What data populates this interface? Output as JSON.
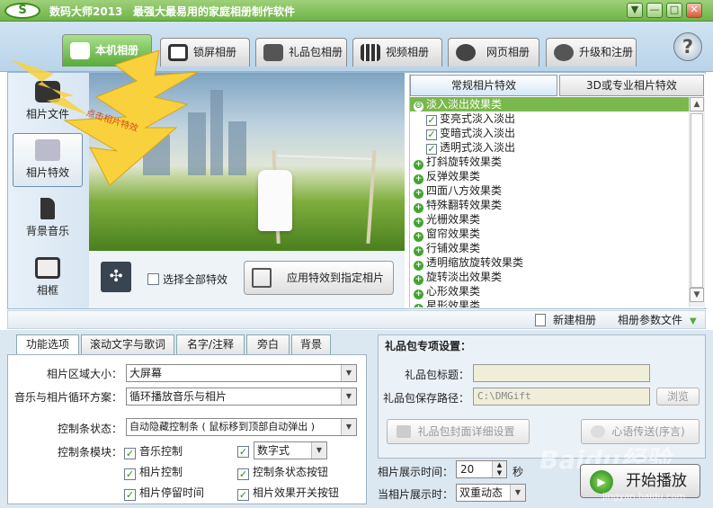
{
  "titlebar": {
    "logo_text": "S",
    "app_name": "数码大师2013",
    "slogan": "最强大最易用的家庭相册制作软件",
    "window_buttons": [
      "▼",
      "—",
      "□",
      "✕"
    ]
  },
  "top_tabs": [
    {
      "label": "本机相册",
      "icon": "photo-album-icon",
      "active": true
    },
    {
      "label": "锁屏相册",
      "icon": "monitor-icon"
    },
    {
      "label": "礼品包相册",
      "icon": "gift-icon"
    },
    {
      "label": "视频相册",
      "icon": "film-icon"
    },
    {
      "label": "网页相册",
      "icon": "ie-icon"
    },
    {
      "label": "升级和注册",
      "icon": "globe-icon"
    }
  ],
  "help_label": "?",
  "left_nav": [
    {
      "label": "相片文件",
      "icon": "camera-icon"
    },
    {
      "label": "相片特效",
      "icon": "effects-icon",
      "active": true
    },
    {
      "label": "背景音乐",
      "icon": "music-note-icon"
    },
    {
      "label": "相框",
      "icon": "frame-icon"
    }
  ],
  "callout_text": "点击相片特效",
  "photo_controls": {
    "select_all_label": "选择全部特效",
    "apply_button": "应用特效到指定相片"
  },
  "effect_tabs": [
    "常规相片特效",
    "3D或专业相片特效"
  ],
  "effect_tree": [
    {
      "label": "淡入淡出效果类",
      "type": "expanded",
      "selected": true
    },
    {
      "label": "变亮式淡入淡出",
      "type": "child",
      "checked": true
    },
    {
      "label": "变暗式淡入淡出",
      "type": "child",
      "checked": true
    },
    {
      "label": "透明式淡入淡出",
      "type": "child",
      "checked": true
    },
    {
      "label": "打斜旋转效果类",
      "type": "collapsed"
    },
    {
      "label": "反弹效果类",
      "type": "collapsed"
    },
    {
      "label": "四面八方效果类",
      "type": "collapsed"
    },
    {
      "label": "特殊翻转效果类",
      "type": "collapsed"
    },
    {
      "label": "光栅效果类",
      "type": "collapsed"
    },
    {
      "label": "窗帘效果类",
      "type": "collapsed"
    },
    {
      "label": "行铺效果类",
      "type": "collapsed"
    },
    {
      "label": "透明缩放旋转效果类",
      "type": "collapsed"
    },
    {
      "label": "旋转淡出效果类",
      "type": "collapsed"
    },
    {
      "label": "心形效果类",
      "type": "collapsed"
    },
    {
      "label": "星形效果类",
      "type": "collapsed"
    }
  ],
  "midbar": {
    "new_album": "新建相册",
    "album_params": "相册参数文件"
  },
  "bottom_tabs": [
    "功能选项",
    "滚动文字与歌词",
    "名字/注释",
    "旁白",
    "背景"
  ],
  "func": {
    "area_size_label": "相片区域大小：",
    "area_size_value": "大屏幕",
    "loop_label": "音乐与相片循环方案：",
    "loop_value": "循环播放音乐与相片",
    "control_state_label": "控制条状态：",
    "control_state_value": "自动隐藏控制条 ( 鼠标移到顶部自动弹出 )",
    "control_module_label": "控制条模块：",
    "options": [
      {
        "label": "音乐控制",
        "checked": true
      },
      {
        "label": "数字式",
        "checked": true
      },
      {
        "label": "相片控制",
        "checked": true
      },
      {
        "label": "控制条状态按钮",
        "checked": true
      },
      {
        "label": "相片停留时间",
        "checked": true
      },
      {
        "label": "相片效果开关按钮",
        "checked": true
      }
    ]
  },
  "gift": {
    "title": "礼品包专项设置：",
    "gift_title_label": "礼品包标题：",
    "gift_title_value": "",
    "save_path_label": "礼品包保存路径：",
    "save_path_value": "C:\\DMGift",
    "browse_button": "浏览",
    "cover_button": "礼品包封面详细设置",
    "message_button": "心语传送(序言)"
  },
  "display": {
    "time_label": "相片展示时间：",
    "time_value": "20",
    "time_unit": "秒",
    "when_label": "当相片展示时：",
    "when_value": "双重动态"
  },
  "start_button": "开始播放",
  "watermark": "Baidu经验",
  "watermark_url": "jingyan.baidu.com"
}
